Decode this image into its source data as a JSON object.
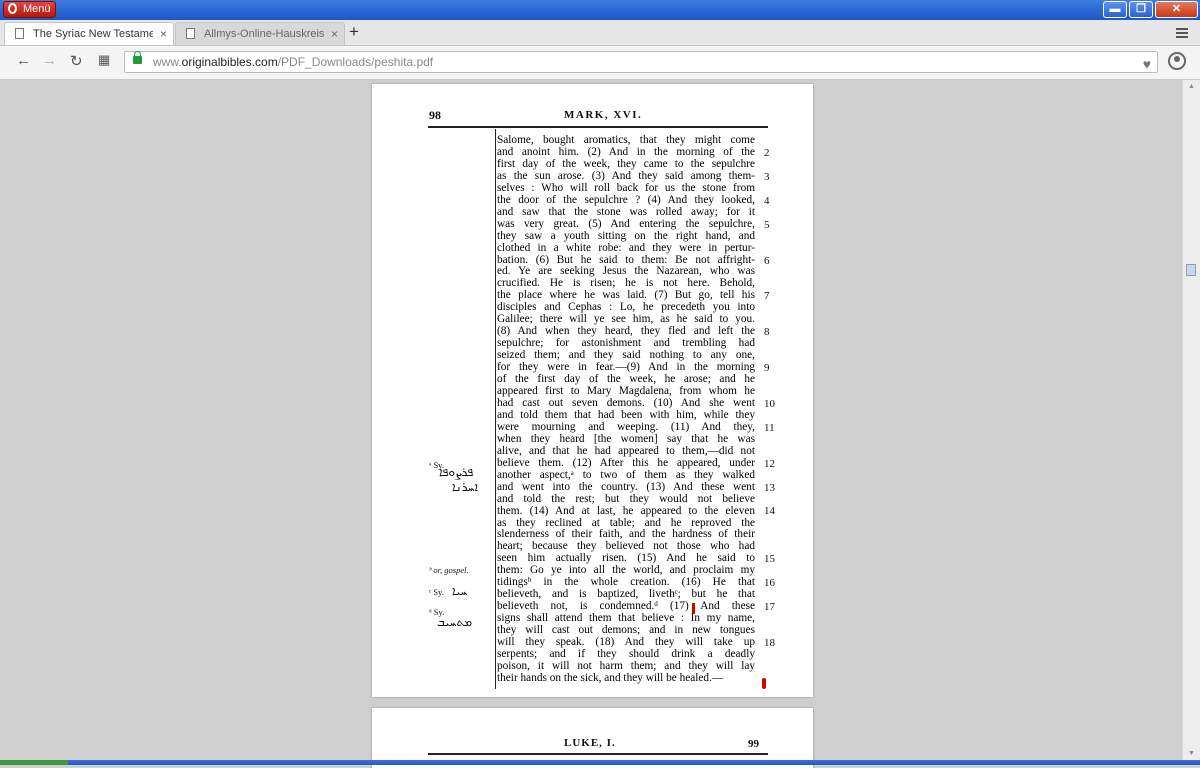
{
  "browser": {
    "menu_label": "Menü",
    "window_buttons": {
      "minimize": "▬",
      "maximize": "❐",
      "close": "✕"
    },
    "tabs": [
      {
        "label": "The Syriac New Testament",
        "close": "×"
      },
      {
        "label": "Allmys-Online-Hauskreis (Sei",
        "close": "×"
      }
    ],
    "new_tab": "+",
    "nav": {
      "back": "←",
      "forward": "→",
      "reload": "↻",
      "apps": "▦"
    },
    "url": {
      "prefix": "www.",
      "host": "originalbibles.com",
      "path": "/PDF_Downloads/peshita.pdf"
    },
    "heart": "♥"
  },
  "pdf": {
    "page1": {
      "page_number": "98",
      "header": "MARK, XVI.",
      "lines": [
        "Salome, bought aromatics, that they might come",
        "and anoint him.  (2) And in the morning of the",
        "first day of the week, they came to the sepulchre",
        "as the sun arose.  (3) And they said among them-",
        "selves : Who will roll back for us the stone from",
        "the door of the sepulchre ?  (4) And they looked,",
        "and saw that the stone was rolled away; for it",
        "was very great.  (5) And entering the sepulchre,",
        "they saw a youth sitting on the right hand, and",
        "clothed in a white robe: and they were in pertur-",
        "bation.  (6) But he said to them:  Be not affright-",
        "ed.  Ye are seeking Jesus the Nazarean, who was",
        "crucified.  He is risen; he is not here.  Behold,",
        "the place where he was laid.  (7) But go, tell his",
        "disciples and Cephas : Lo, he precedeth you into",
        "Galilee; there will ye see him, as he said to you.",
        "(8) And when they heard, they fled and left the",
        "sepulchre; for astonishment and trembling had",
        "seized them; and they said nothing to any one,",
        "for they were in fear.—(9) And in the morning",
        "of the first day of the week, he arose; and he",
        "appeared first to Mary Magdalena, from whom he",
        "had cast out seven demons.  (10) And she went",
        "and told them that had been with him, while they",
        "were mourning and weeping.  (11) And they,",
        "when they heard [the women] say that he was",
        "alive, and that he had appeared to them,—did not",
        "believe them.  (12) After this he appeared, under",
        "another aspect,ᵃ to two of them as they walked",
        "and went into the country.  (13) And these went",
        "and told the rest; but they would not believe",
        "them.  (14) And at last, he appeared to the eleven",
        "as they reclined at table; and he reproved the",
        "slenderness of their faith, and the hardness of their",
        "heart; because they believed not those who had",
        "seen him actually risen.  (15) And he said to",
        "them: Go ye into all the world, and proclaim my",
        "tidingsᵇ in the whole creation.  (16) He that",
        "believeth, and is baptized, livethᶜ; but he that",
        "believeth not, is condemned.ᵈ  (17) And these",
        "signs shall attend them that believe : In my name,",
        "they will cast out demons; and in new tongues",
        "will they speak.  (18) And they will take up",
        "serpents; and if they should drink a deadly",
        "poison, it will not harm them; and they will lay",
        "their hands on the sick, and they will be healed.—"
      ],
      "verse_numbers": [
        {
          "n": "2",
          "line": 1
        },
        {
          "n": "3",
          "line": 3
        },
        {
          "n": "4",
          "line": 5
        },
        {
          "n": "5",
          "line": 7
        },
        {
          "n": "6",
          "line": 10
        },
        {
          "n": "7",
          "line": 13
        },
        {
          "n": "8",
          "line": 16
        },
        {
          "n": "9",
          "line": 19
        },
        {
          "n": "10",
          "line": 22
        },
        {
          "n": "11",
          "line": 24
        },
        {
          "n": "12",
          "line": 27
        },
        {
          "n": "13",
          "line": 29
        },
        {
          "n": "14",
          "line": 31
        },
        {
          "n": "15",
          "line": 35
        },
        {
          "n": "16",
          "line": 37
        },
        {
          "n": "17",
          "line": 39
        },
        {
          "n": "18",
          "line": 42
        }
      ],
      "notes": {
        "a": "ᵃ Sy.",
        "b": "ᵇ or, gospel.",
        "c": "ᶜ Sy.",
        "d": "ᵈ Sy."
      }
    },
    "page2": {
      "header": "LUKE, I.",
      "page_number": "99"
    }
  }
}
